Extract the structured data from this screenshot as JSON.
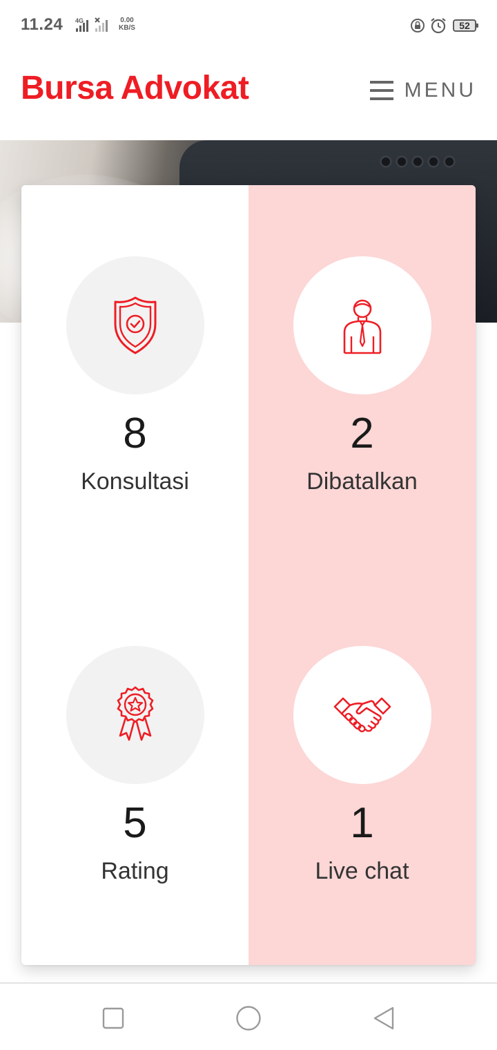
{
  "status_bar": {
    "time": "11.24",
    "network_label": "4G",
    "speed_value": "0.00",
    "speed_unit": "KB/S",
    "battery_level": "52"
  },
  "header": {
    "brand": "Bursa Advokat",
    "menu_label": "MENU"
  },
  "stats": [
    {
      "value": "8",
      "label": "Konsultasi",
      "icon": "shield-check-icon"
    },
    {
      "value": "2",
      "label": "Dibatalkan",
      "icon": "lawyer-person-icon"
    },
    {
      "value": "5",
      "label": "Rating",
      "icon": "award-badge-icon"
    },
    {
      "value": "1",
      "label": "Live chat",
      "icon": "handshake-icon"
    }
  ],
  "nav_bar": {
    "buttons": [
      "recents-button",
      "home-button",
      "back-button"
    ]
  },
  "colors": {
    "brand": "#ee1d24",
    "accent_column": "#fdd6d6",
    "icon_stroke": "#ee1d24"
  }
}
